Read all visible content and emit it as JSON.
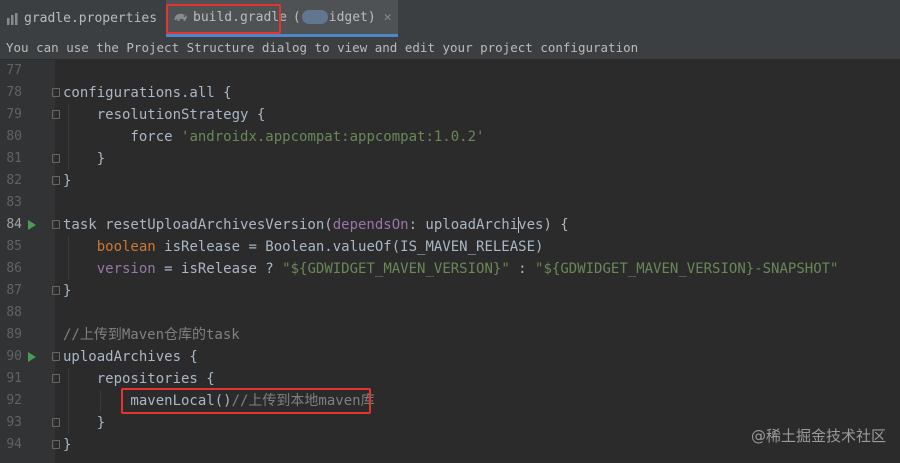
{
  "tabs": [
    {
      "name": "gradle.properties",
      "icon": "gradle-properties-icon"
    },
    {
      "name": "build.gradle",
      "module_prefix": "(",
      "module_suffix": "idget)",
      "icon": "gradle-elephant-icon",
      "active": true
    }
  ],
  "info_bar": "You can use the Project Structure dialog to view and edit your project configuration",
  "lines": [
    {
      "n": "77",
      "t": ""
    },
    {
      "n": "78",
      "t": "configurations.all {"
    },
    {
      "n": "79",
      "t": "    resolutionStrategy {"
    },
    {
      "n": "80",
      "a": "        force ",
      "b": "'androidx.appcompat:appcompat:1.0.2'"
    },
    {
      "n": "81",
      "t": "    }"
    },
    {
      "n": "82",
      "t": "}"
    },
    {
      "n": "83",
      "t": ""
    },
    {
      "n": "84",
      "a": "task resetUploadArchivesVersion(",
      "b": "dependsOn",
      "c": ": uploadArchi",
      "d": "ves) {"
    },
    {
      "n": "85",
      "a": "    ",
      "b": "boolean",
      "c": " isRelease = Boolean.valueOf(IS_MAVEN_RELEASE)"
    },
    {
      "n": "86",
      "a": "    ",
      "b": "version",
      "c": " = isRelease ? ",
      "d": "\"${GDWIDGET_MAVEN_VERSION}\"",
      "e": " : ",
      "f": "\"${GDWIDGET_MAVEN_VERSION}",
      "g": "-SNAPSHOT\""
    },
    {
      "n": "87",
      "t": "}"
    },
    {
      "n": "88",
      "t": ""
    },
    {
      "n": "89",
      "c": "//上传到Maven仓库的task"
    },
    {
      "n": "90",
      "t": "uploadArchives {"
    },
    {
      "n": "91",
      "t": "    repositories {"
    },
    {
      "n": "92",
      "a": "        mavenLocal()",
      "c": "//上传到本地maven库"
    },
    {
      "n": "93",
      "t": "    }"
    },
    {
      "n": "94",
      "t": "}"
    }
  ],
  "watermark": "@稀土掘金技术社区",
  "colors": {
    "keyword": "#cc7832",
    "string": "#6a8759",
    "parameter": "#9876aa",
    "comment": "#808080",
    "highlight": "#e5332d"
  }
}
